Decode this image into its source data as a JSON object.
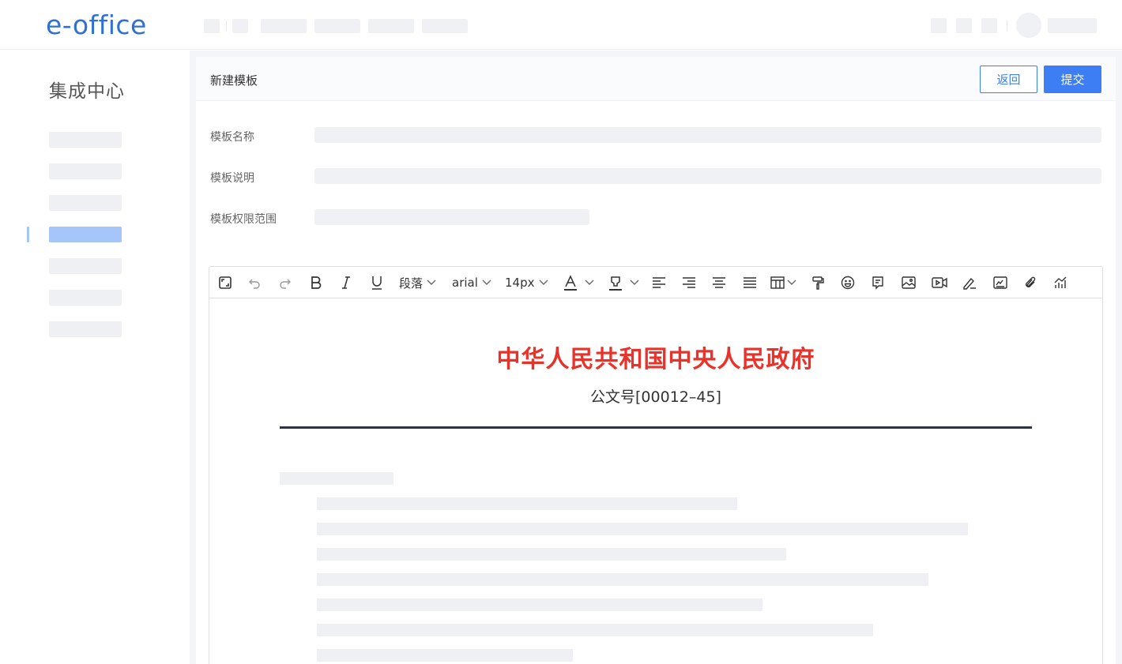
{
  "header": {
    "logo_text": "e-office"
  },
  "sidebar": {
    "title": "集成中心"
  },
  "panel": {
    "title": "新建模板",
    "back_label": "返回",
    "submit_label": "提交"
  },
  "form": {
    "name_label": "模板名称",
    "desc_label": "模板说明",
    "scope_label": "模板权限范围"
  },
  "toolbar": {
    "paragraph_label": "段落",
    "font_label": "arial",
    "size_label": "14px",
    "icons": [
      "fullscreen-icon",
      "undo-icon",
      "redo-icon",
      "bold-icon",
      "italic-icon",
      "underline-icon",
      "font-color-icon",
      "highlight-icon",
      "align-left-icon",
      "align-right-icon",
      "align-center-icon",
      "justify-icon",
      "table-icon",
      "format-painter-icon",
      "emoji-icon",
      "note-icon",
      "image-icon",
      "video-icon",
      "signature-icon",
      "seal-icon",
      "attachment-icon",
      "chart-icon"
    ]
  },
  "document": {
    "title": "中华人民共和国中央人民政府",
    "number": "公文号[00012–45]",
    "title_color": "#e8322a",
    "rule_color": "#2d3345"
  },
  "colors": {
    "accent": "#3d7ef5",
    "placeholder": "#f0f1f5",
    "active_nav": "#a6c5fb"
  }
}
